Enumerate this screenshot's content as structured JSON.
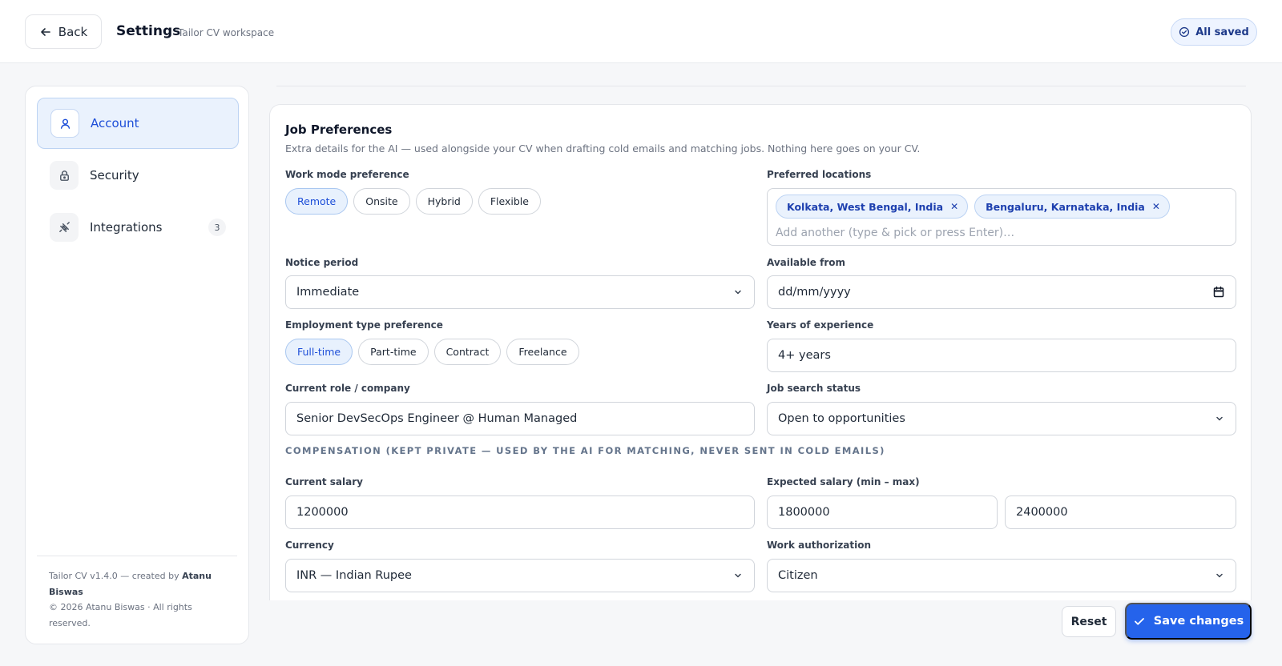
{
  "header": {
    "back_label": "Back",
    "title": "Settings",
    "subtitle": "Tailor CV workspace",
    "saved_status": "All saved"
  },
  "sidebar": {
    "items": [
      {
        "label": "Account",
        "icon": "user-icon",
        "active": true
      },
      {
        "label": "Security",
        "icon": "lock-icon",
        "active": false
      },
      {
        "label": "Integrations",
        "icon": "plug-icon",
        "active": false,
        "badge": "3"
      }
    ],
    "footer": {
      "version_text": "Tailor CV v1.4.0 — created by",
      "author": "Atanu Biswas",
      "copyright": "© 2026 Atanu Biswas · All rights reserved."
    }
  },
  "job_preferences": {
    "title": "Job Preferences",
    "description": "Extra details for the AI — used alongside your CV when drafting cold emails and matching jobs. Nothing here goes on your CV.",
    "work_mode": {
      "label": "Work mode preference",
      "options": [
        "Remote",
        "Onsite",
        "Hybrid",
        "Flexible"
      ],
      "selected": "Remote"
    },
    "preferred_locations": {
      "label": "Preferred locations",
      "tags": [
        "Kolkata, West Bengal, India",
        "Bengaluru, Karnataka, India"
      ],
      "placeholder": "Add another (type & pick or press Enter)…"
    },
    "notice_period": {
      "label": "Notice period",
      "value": "Immediate"
    },
    "available_from": {
      "label": "Available from",
      "value": "dd/mm/yyyy"
    },
    "employment_type": {
      "label": "Employment type preference",
      "options": [
        "Full-time",
        "Part-time",
        "Contract",
        "Freelance"
      ],
      "selected": "Full-time"
    },
    "years_experience": {
      "label": "Years of experience",
      "value": "4+ years"
    },
    "current_role": {
      "label": "Current role / company",
      "value": "Senior DevSecOps Engineer @ Human Managed"
    },
    "job_search_status": {
      "label": "Job search status",
      "value": "Open to opportunities"
    },
    "compensation_heading": "COMPENSATION (KEPT PRIVATE — USED BY THE AI FOR MATCHING, NEVER SENT IN COLD EMAILS)",
    "current_salary": {
      "label": "Current salary",
      "value": "1200000"
    },
    "expected_salary": {
      "label": "Expected salary (min – max)",
      "min": "1800000",
      "max": "2400000"
    },
    "currency": {
      "label": "Currency",
      "value": "INR — Indian Rupee"
    },
    "work_authorization": {
      "label": "Work authorization",
      "value": "Citizen"
    }
  },
  "actions": {
    "reset_label": "Reset",
    "save_label": "Save changes"
  },
  "colors": {
    "accent": "#2563eb",
    "accent_light": "#eaf2fd",
    "border": "#d1d5db"
  }
}
